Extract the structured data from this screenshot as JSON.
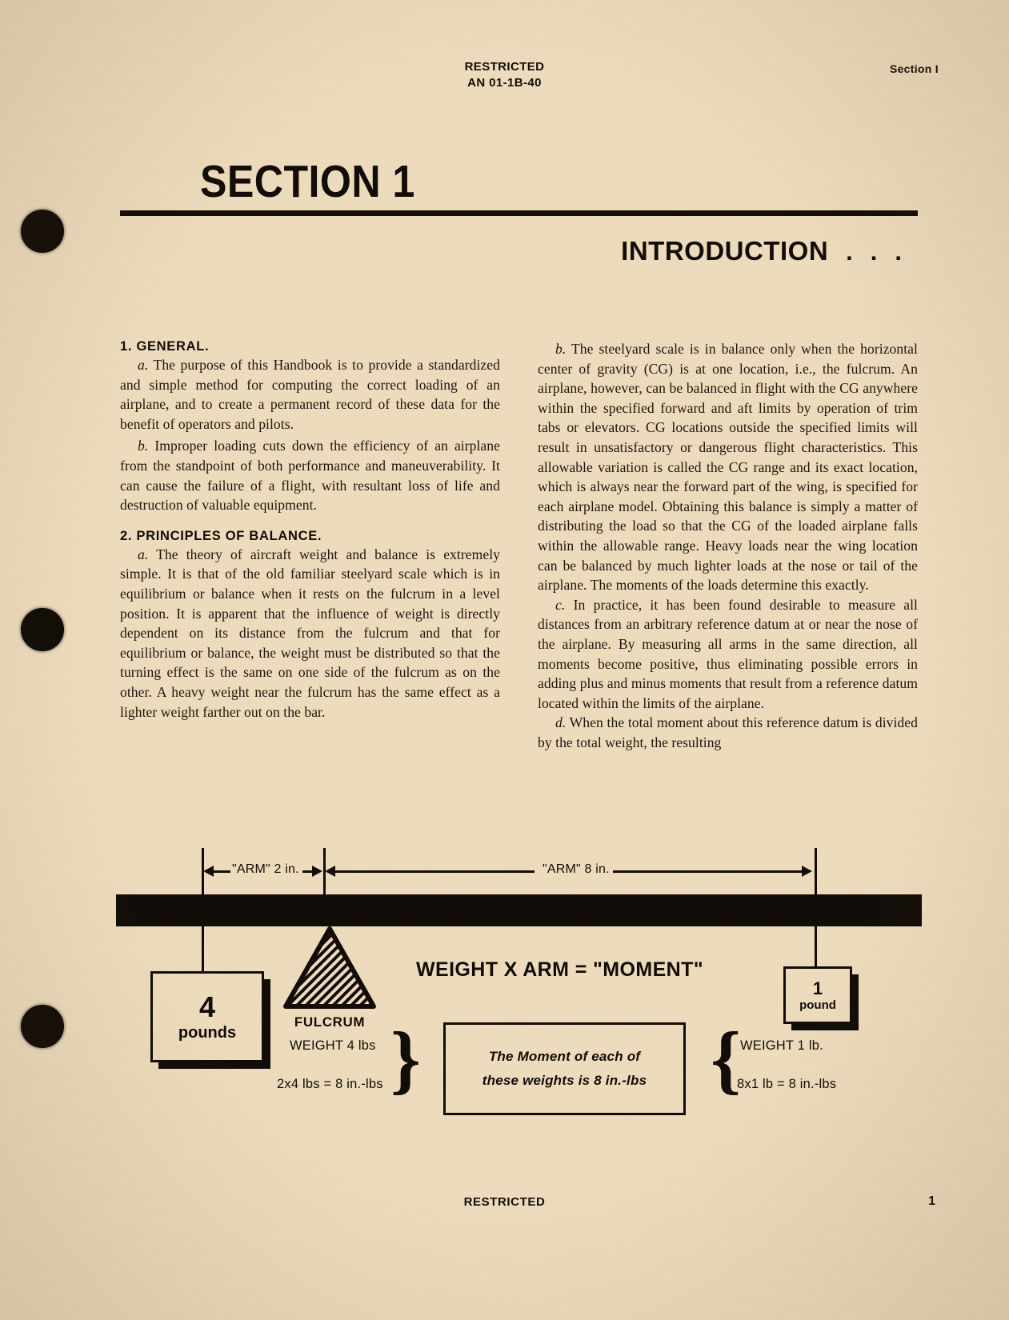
{
  "header": {
    "classification": "RESTRICTED",
    "doc_number": "AN 01-1B-40",
    "section_right": "Section I"
  },
  "title": {
    "section": "SECTION 1",
    "intro": "INTRODUCTION",
    "intro_dots": "..."
  },
  "left_column": {
    "heading_1": "1. GENERAL.",
    "para_1a_label": "a.",
    "para_1a": "The purpose of this Handbook is to provide a standardized and simple method for computing the correct loading of an airplane, and to create a permanent record of these data for the benefit of operators and pilots.",
    "para_1b_label": "b.",
    "para_1b": "Improper loading cuts down the efficiency of an airplane from the standpoint of both performance and maneuverability. It can cause the failure of a flight, with resultant loss of life and destruction of valuable equipment.",
    "heading_2": "2. PRINCIPLES OF BALANCE.",
    "para_2a_label": "a.",
    "para_2a": "The theory of aircraft weight and balance is extremely simple. It is that of the old familiar steelyard scale which is in equilibrium or balance when it rests on the fulcrum in a level position. It is apparent that the influence of weight is directly dependent on its distance from the fulcrum and that for equilibrium or balance, the weight must be distributed so that the turning effect is the same on one side of the fulcrum as on the other. A heavy weight near the fulcrum has the same effect as a lighter weight farther out on the bar."
  },
  "right_column": {
    "para_2b_label": "b.",
    "para_2b": "The steelyard scale is in balance only when the horizontal center of gravity (CG) is at one location, i.e., the fulcrum. An airplane, however, can be balanced in flight with the CG anywhere within the specified forward and aft limits by operation of trim tabs or elevators. CG locations outside the specified limits will result in unsatisfactory or dangerous flight characteristics. This allowable variation is called the CG range and its exact location, which is always near the forward part of the wing, is specified for each airplane model. Obtaining this balance is simply a matter of distributing the load so that the CG of the loaded airplane falls within the allowable range. Heavy loads near the wing location can be balanced by much lighter loads at the nose or tail of the airplane. The moments of the loads determine this exactly.",
    "para_2c_label": "c.",
    "para_2c": "In practice, it has been found desirable to measure all distances from an arbitrary reference datum at or near the nose of the airplane. By measuring all arms in the same direction, all moments become positive, thus eliminating possible errors in adding plus and minus moments that result from a reference datum located within the limits of the airplane.",
    "para_2d_label": "d.",
    "para_2d": "When the total moment about this reference datum is divided by the total weight, the resulting"
  },
  "figure": {
    "dim_left_label": "\"ARM\" 2 in.",
    "dim_right_label": "\"ARM\" 8 in.",
    "left_weight_value": "4",
    "left_weight_unit": "pounds",
    "right_weight_value": "1",
    "right_weight_unit": "pound",
    "fulcrum_label": "FULCRUM",
    "headline": "WEIGHT X ARM = \"MOMENT\"",
    "left_weight_text": "WEIGHT 4 lbs",
    "left_equation": "2x4 lbs = 8 in.-lbs",
    "right_weight_text": "WEIGHT 1 lb.",
    "right_equation": "8x1 lb = 8 in.-lbs",
    "center_line_1": "The Moment of each of",
    "center_line_2": "these weights is 8 in.-lbs",
    "brace_glyph": "}"
  },
  "footer": {
    "classification": "RESTRICTED",
    "page_number": "1"
  }
}
